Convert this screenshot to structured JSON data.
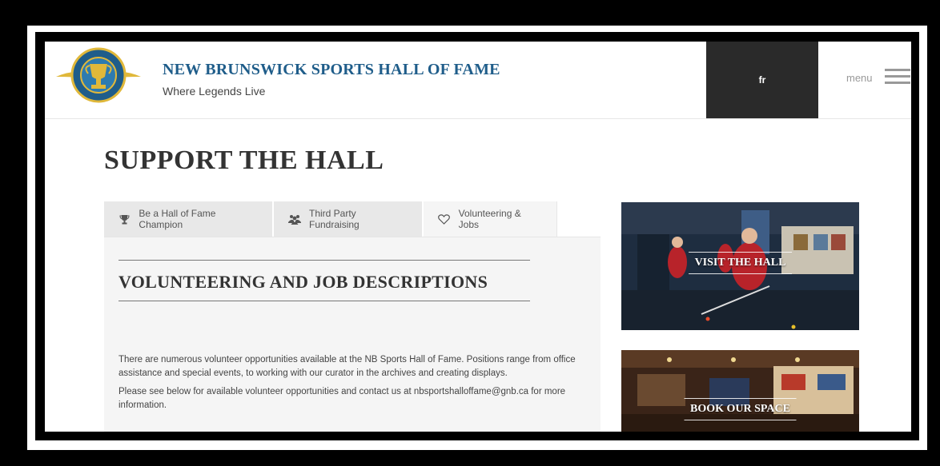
{
  "header": {
    "site_title": "NEW BRUNSWICK SPORTS HALL OF FAME",
    "tagline": "Where Legends Live",
    "language_toggle": "fr",
    "menu_label": "menu",
    "logo_icon": "hall-of-fame-trophy-logo"
  },
  "page": {
    "title": "SUPPORT THE HALL"
  },
  "tabs": [
    {
      "label": "Be a Hall of Fame Champion",
      "icon": "trophy-icon",
      "active": false
    },
    {
      "label": "Third Party Fundraising",
      "icon": "users-icon",
      "active": false
    },
    {
      "label": "Volunteering & Jobs",
      "icon": "heart-icon",
      "active": true
    }
  ],
  "content": {
    "heading": "VOLUNTEERING AND JOB DESCRIPTIONS",
    "paragraph_1": "There are numerous volunteer opportunities available at the NB Sports Hall of Fame. Positions range from office assistance and special events, to working with our curator in the archives and creating displays.",
    "paragraph_2": "Please see below for available volunteer opportunities and contact us at nbsportshalloffame@gnb.ca for more information."
  },
  "promos": {
    "visit_label": "VISIT THE HALL",
    "book_label": "BOOK OUR SPACE"
  },
  "colors": {
    "brand_blue": "#1f5d8a",
    "dark_box": "#2a2a2a",
    "tab_bg": "#e8e8e8",
    "panel_bg": "#f5f5f5"
  }
}
